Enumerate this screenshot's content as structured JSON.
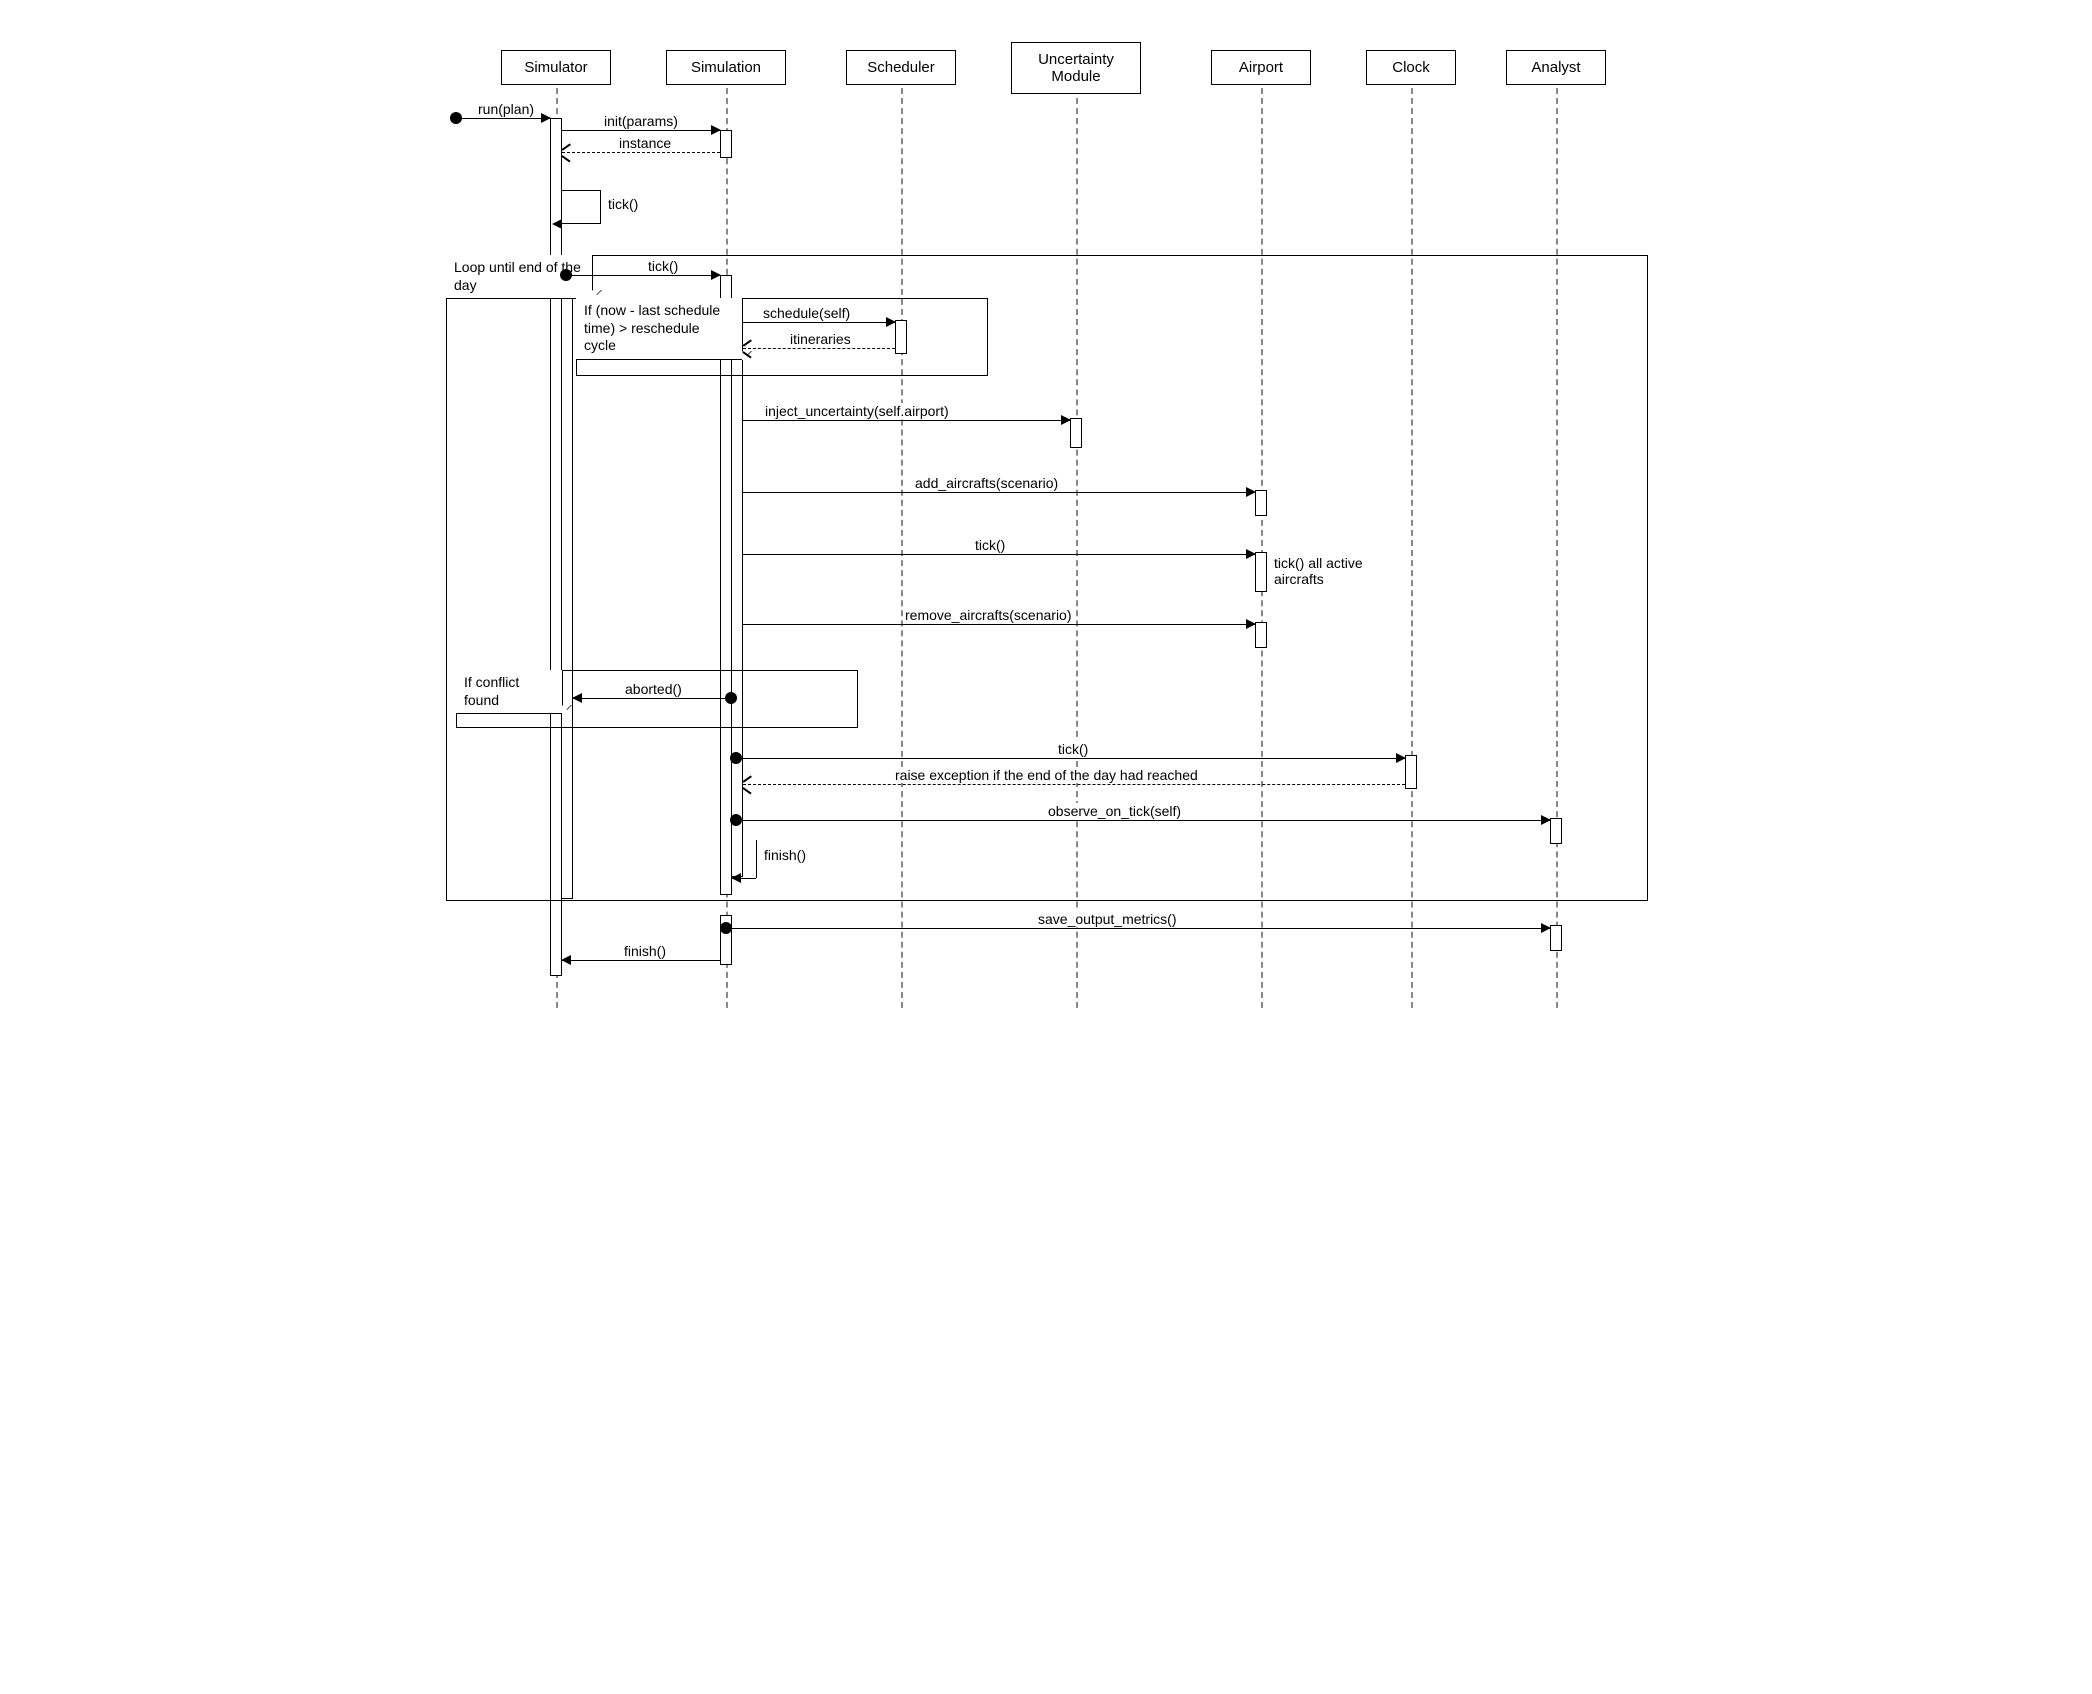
{
  "participants": {
    "simulator": "Simulator",
    "simulation": "Simulation",
    "scheduler": "Scheduler",
    "uncertainty": "Uncertainty Module",
    "airport": "Airport",
    "clock": "Clock",
    "analyst": "Analyst"
  },
  "frames": {
    "loop": "Loop until end of the day",
    "reschedule": "If (now - last schedule time) > reschedule cycle",
    "conflict": "If conflict found"
  },
  "messages": {
    "run": "run(plan)",
    "init": "init(params)",
    "instance": "instance",
    "self_tick": "tick()",
    "loop_tick": "tick()",
    "schedule": "schedule(self)",
    "itineraries": "itineraries",
    "inject": "inject_uncertainty(self.airport)",
    "add_ac": "add_aircrafts(scenario)",
    "tick_airport": "tick()",
    "tick_note": "tick() all active aircrafts",
    "remove_ac": "remove_aircrafts(scenario)",
    "aborted": "aborted()",
    "clock_tick": "tick()",
    "clock_exception": "raise exception if the end of the day had reached",
    "observe": "observe_on_tick(self)",
    "finish_self": "finish()",
    "save_metrics": "save_output_metrics()",
    "finish": "finish()"
  }
}
